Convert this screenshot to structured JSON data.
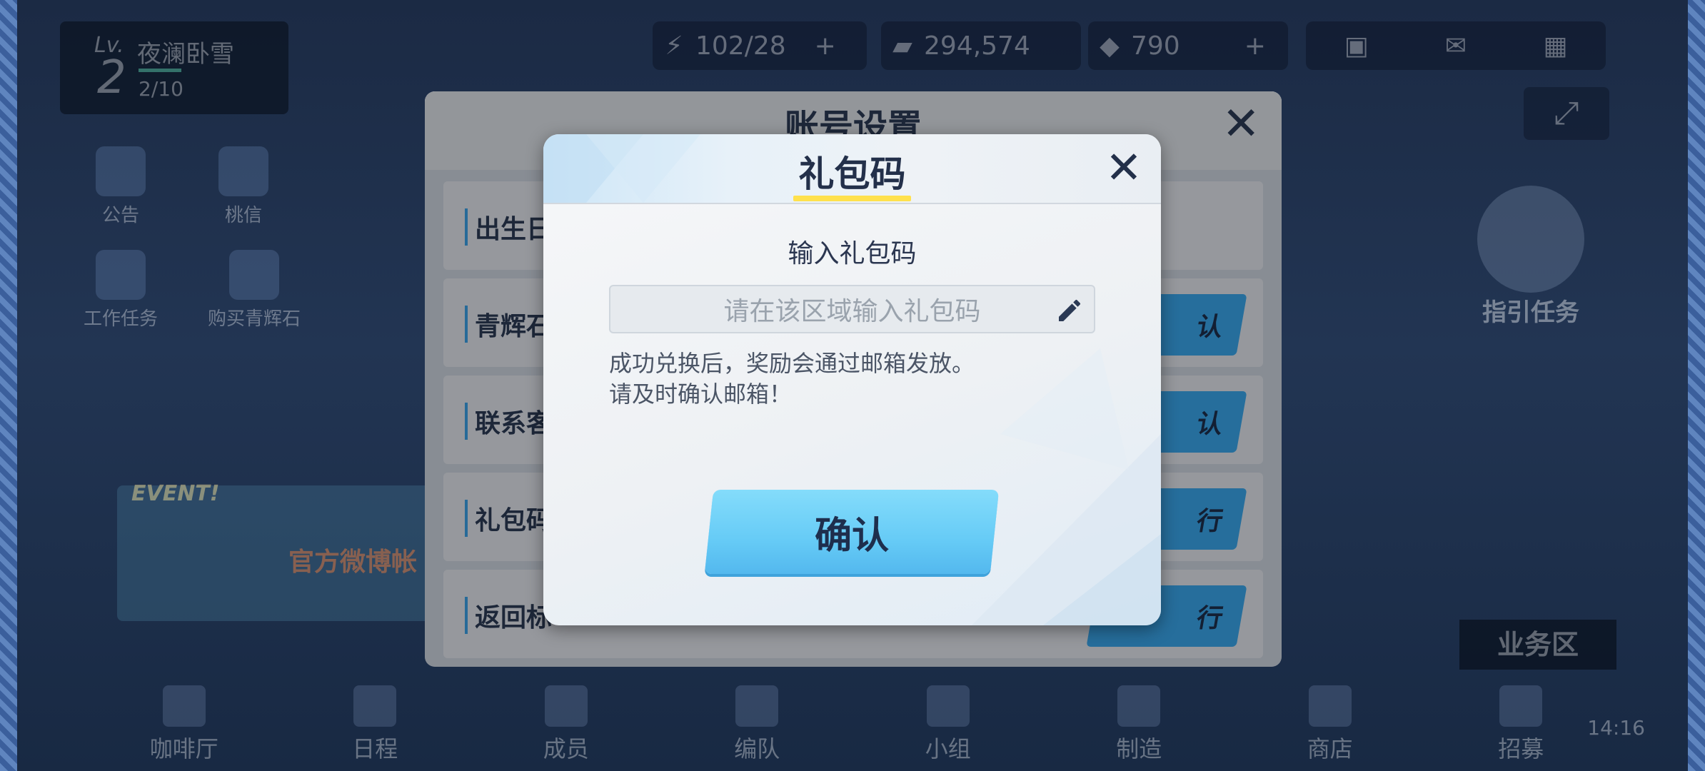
{
  "player": {
    "level_prefix": "Lv.",
    "level": "2",
    "name": "夜澜卧雪",
    "exp": "2/10"
  },
  "resources": {
    "ap": "102/28",
    "credits": "294,574",
    "gems": "790",
    "plus": "+"
  },
  "side_menu": {
    "notice": "公告",
    "momotalk": "桃信",
    "work_task": "工作任务",
    "buy_gems": "购买青辉石"
  },
  "right_panel": {
    "guide_task": "指引任务",
    "business_area": "业务区"
  },
  "event": {
    "tag": "EVENT!",
    "banner": "官方微博帐"
  },
  "bottom_nav": [
    {
      "label": "咖啡厅"
    },
    {
      "label": "日程"
    },
    {
      "label": "成员"
    },
    {
      "label": "编队"
    },
    {
      "label": "小组"
    },
    {
      "label": "制造"
    },
    {
      "label": "商店"
    },
    {
      "label": "招募"
    }
  ],
  "clock": "14:16",
  "account_panel": {
    "title": "账号设置",
    "close_glyph": "✕",
    "rows": [
      {
        "label": "出生日",
        "button": ""
      },
      {
        "label": "青辉石",
        "button": "认"
      },
      {
        "label": "联系客",
        "button": "认"
      },
      {
        "label": "礼包码",
        "button": "行"
      },
      {
        "label": "返回标",
        "button": "行"
      }
    ]
  },
  "gift_dialog": {
    "title": "礼包码",
    "close_glyph": "✕",
    "input_label": "输入礼包码",
    "input_placeholder": "请在该区域输入礼包码",
    "hint_line1": "成功兑换后，奖励会通过邮箱发放。",
    "hint_line2": "请及时确认邮箱！",
    "confirm": "确认"
  }
}
